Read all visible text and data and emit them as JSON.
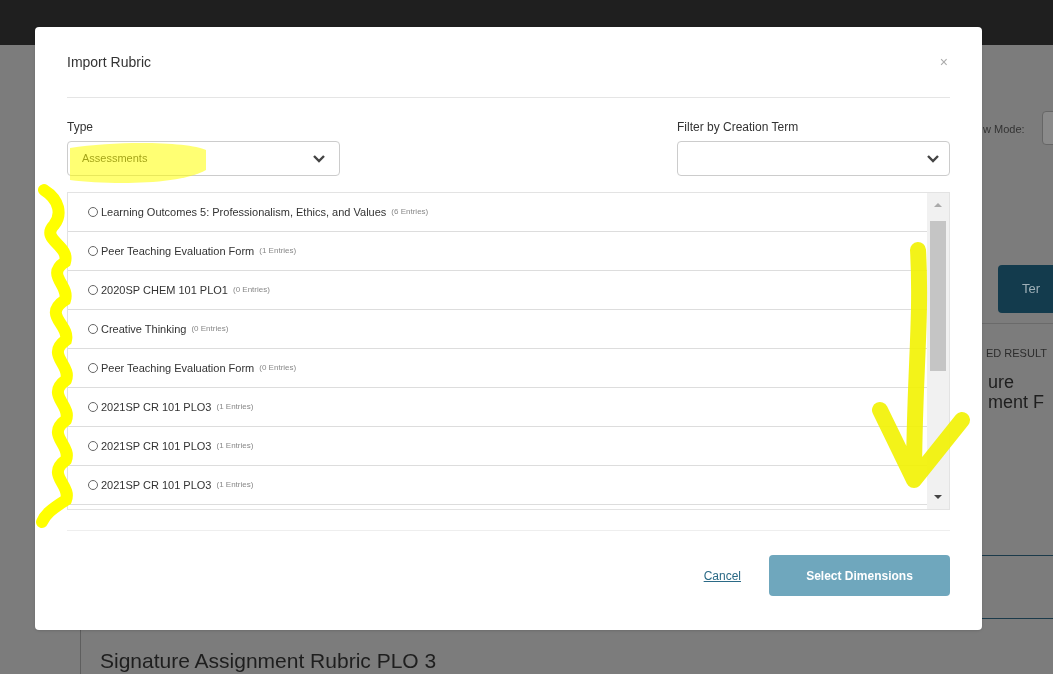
{
  "background_page": {
    "view_mode_label": "w Mode:",
    "term_button": "Ter",
    "section_label": "ED RESULT",
    "heading_lines": [
      "ure",
      "ment F"
    ],
    "bottom_title": "Signature Assignment Rubric PLO 3"
  },
  "dialog": {
    "title": "Import Rubric",
    "close": "×",
    "type_field": {
      "label": "Type",
      "value": "Assessments"
    },
    "term_field": {
      "label": "Filter by Creation Term"
    },
    "rubrics": [
      {
        "name": "Learning Outcomes 5: Professionalism, Ethics, and Values",
        "entries": "(6 Entries)",
        "selected": false
      },
      {
        "name": "Peer Teaching Evaluation Form",
        "entries": "(1 Entries)",
        "selected": false
      },
      {
        "name": "2020SP CHEM 101 PLO1",
        "entries": "(0 Entries)",
        "selected": false
      },
      {
        "name": "Creative Thinking",
        "entries": "(0 Entries)",
        "selected": false
      },
      {
        "name": "Peer Teaching Evaluation Form",
        "entries": "(0 Entries)",
        "selected": false
      },
      {
        "name": "2021SP CR 101 PLO3",
        "entries": "(1 Entries)",
        "selected": false
      },
      {
        "name": "2021SP CR 101 PLO3",
        "entries": "(1 Entries)",
        "selected": false
      },
      {
        "name": "2021SP CR 101 PLO3",
        "entries": "(1 Entries)",
        "selected": false
      }
    ],
    "cancel": "Cancel",
    "submit": "Select Dimensions"
  }
}
